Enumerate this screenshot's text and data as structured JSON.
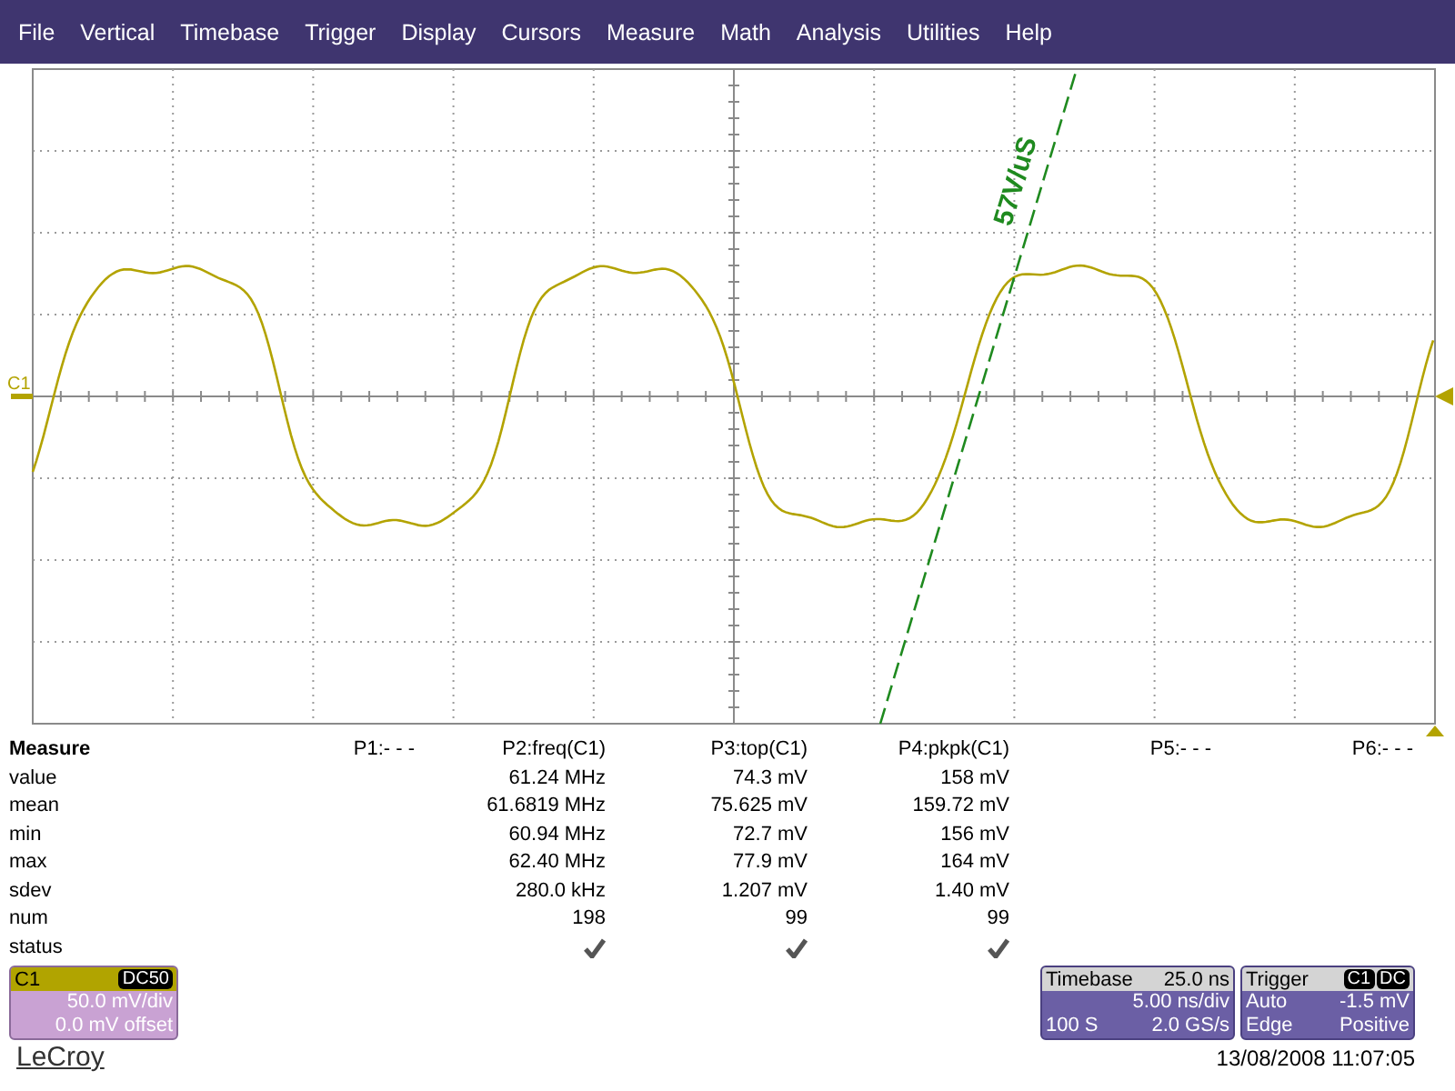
{
  "menu": [
    "File",
    "Vertical",
    "Timebase",
    "Trigger",
    "Display",
    "Cursors",
    "Measure",
    "Math",
    "Analysis",
    "Utilities",
    "Help"
  ],
  "scope": {
    "channel_label": "C1",
    "slope_annotation": "57V/uS"
  },
  "measure": {
    "title": "Measure",
    "row_labels": [
      "value",
      "mean",
      "min",
      "max",
      "sdev",
      "num",
      "status"
    ],
    "params": [
      {
        "header": "P1:- - -"
      },
      {
        "header": "P2:freq(C1)",
        "stats": [
          "61.24 MHz",
          "61.6819 MHz",
          "60.94 MHz",
          "62.40 MHz",
          "280.0 kHz",
          "198"
        ],
        "status_ok": true
      },
      {
        "header": "P3:top(C1)",
        "stats": [
          "74.3 mV",
          "75.625 mV",
          "72.7 mV",
          "77.9 mV",
          "1.207 mV",
          "99"
        ],
        "status_ok": true
      },
      {
        "header": "P4:pkpk(C1)",
        "stats": [
          "158 mV",
          "159.72 mV",
          "156 mV",
          "164 mV",
          "1.40 mV",
          "99"
        ],
        "status_ok": true
      },
      {
        "header": "P5:- - -"
      },
      {
        "header": "P6:- - -"
      }
    ]
  },
  "channel": {
    "name": "C1",
    "coupling": "DC50",
    "scale": "50.0 mV/div",
    "offset": "0.0 mV offset"
  },
  "timebase": {
    "title": "Timebase",
    "delay": "25.0 ns",
    "scale": "5.00 ns/div",
    "samples": "100 S",
    "rate": "2.0 GS/s"
  },
  "trigger": {
    "title": "Trigger",
    "source": "C1",
    "coupling": "DC",
    "mode": "Auto",
    "level": "-1.5 mV",
    "type": "Edge",
    "slope": "Positive"
  },
  "footer": {
    "logo": "LeCroy",
    "timestamp": "13/08/2008 11:07:05"
  }
}
